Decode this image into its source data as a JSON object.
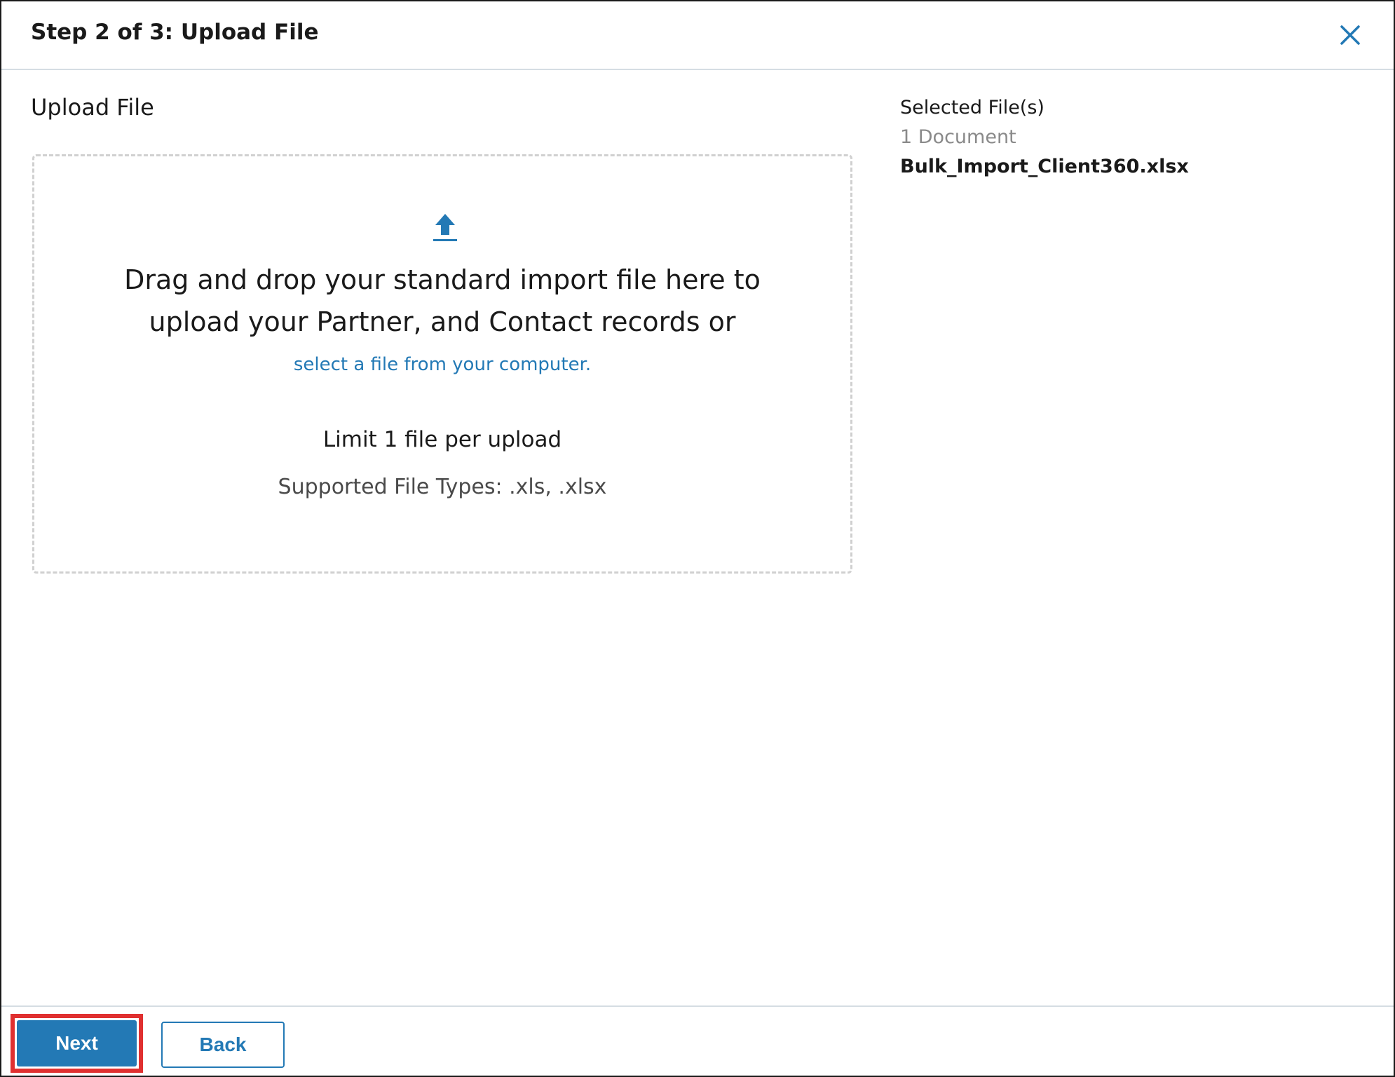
{
  "header": {
    "title": "Step 2 of 3: Upload File",
    "close_icon": "close-icon"
  },
  "upload": {
    "section_title": "Upload File",
    "icon": "upload-arrow-icon",
    "drop_text_line1": "Drag and drop your standard import file here to",
    "drop_text_line2": "upload your Partner, and Contact records or",
    "select_link": "select a file from your computer.",
    "limit_text": "Limit 1 file per upload",
    "types_text": "Supported File Types: .xls, .xlsx"
  },
  "selected": {
    "label": "Selected File(s)",
    "count": "1 Document",
    "file_name": "Bulk_Import_Client360.xlsx"
  },
  "footer": {
    "next_label": "Next",
    "back_label": "Back"
  },
  "colors": {
    "accent": "#2379b5",
    "highlight": "#e03030",
    "divider": "#d5dde3"
  }
}
